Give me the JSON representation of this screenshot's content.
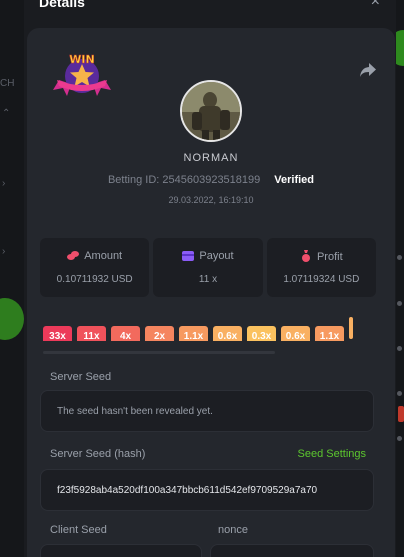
{
  "background": {
    "side_text": "CH"
  },
  "modal": {
    "title": "Details",
    "close_glyph": "×"
  },
  "badge": {
    "text": "WIN"
  },
  "user": {
    "name": "NORMAN",
    "betting_id": "Betting ID: 2545603923518199",
    "verified": "Verified",
    "date": "29.03.2022, 16:19:10"
  },
  "stats": {
    "amount": {
      "label": "Amount",
      "value": "0.10711932 USD",
      "icon": "coins-icon"
    },
    "payout": {
      "label": "Payout",
      "value": "11 x",
      "icon": "wallet-icon"
    },
    "profit": {
      "label": "Profit",
      "value": "1.07119324 USD",
      "icon": "money-bag-icon"
    }
  },
  "multipliers": [
    {
      "label": "33x",
      "color": "#ec3a5a"
    },
    {
      "label": "11x",
      "color": "#f0525b"
    },
    {
      "label": "4x",
      "color": "#f26a5d"
    },
    {
      "label": "2x",
      "color": "#f5855f"
    },
    {
      "label": "1.1x",
      "color": "#f79a60"
    },
    {
      "label": "0.6x",
      "color": "#f9b062"
    },
    {
      "label": "0.3x",
      "color": "#fbc25f"
    },
    {
      "label": "0.6x",
      "color": "#f9b062"
    },
    {
      "label": "1.1x",
      "color": "#f79a60"
    }
  ],
  "server_seed": {
    "label": "Server Seed",
    "value": "The seed hasn't been revealed yet."
  },
  "server_seed_hash": {
    "label": "Server Seed (hash)",
    "link": "Seed Settings",
    "value": "f23f5928ab4a520df100a347bbcb611d542ef9709529a7a70"
  },
  "client_seed": {
    "label": "Client Seed"
  },
  "nonce": {
    "label": "nonce"
  },
  "colors": {
    "accent_green": "#5cc62e",
    "verified": "#ffffff"
  }
}
